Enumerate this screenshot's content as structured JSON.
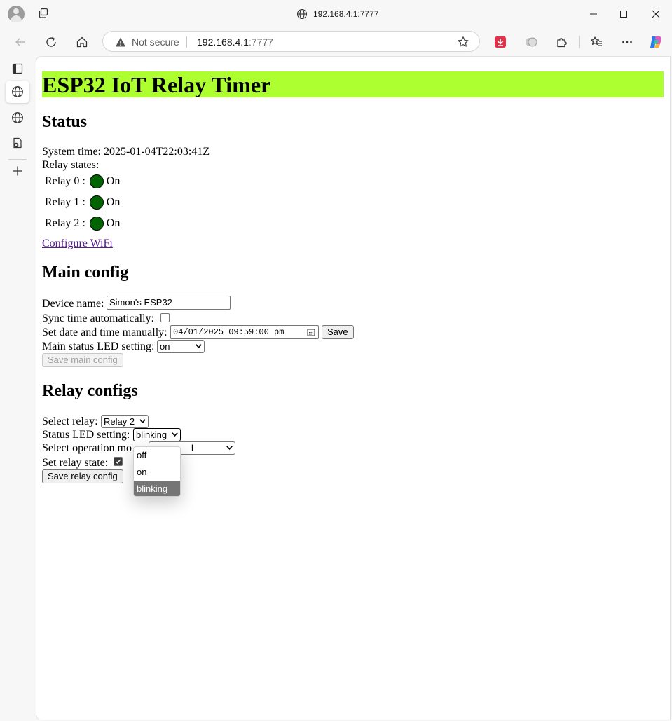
{
  "browser": {
    "window_title": "192.168.4.1:7777",
    "address": {
      "security_label": "Not secure",
      "host": "192.168.4.1",
      "port": ":7777"
    }
  },
  "page": {
    "title": "ESP32 IoT Relay Timer",
    "title_color": "#adff2f",
    "status": {
      "heading": "Status",
      "system_time_label": "System time:",
      "system_time": "2025-01-04T22:03:41Z",
      "relay_states_label": "Relay states:",
      "led_color": "#006400",
      "relays": [
        {
          "label": "Relay 0 :",
          "state": "On"
        },
        {
          "label": "Relay 1 :",
          "state": "On"
        },
        {
          "label": "Relay 2 :",
          "state": "On"
        }
      ],
      "configure_wifi_link": "Configure WiFi"
    },
    "main_config": {
      "heading": "Main config",
      "device_name_label": "Device name:",
      "device_name_value": "Simon's ESP32",
      "sync_time_label": "Sync time automatically:",
      "sync_time_checked": false,
      "set_datetime_label": "Set date and time manually:",
      "datetime_value": "04/01/2025 09:59:00 pm",
      "save_datetime_button": "Save",
      "status_led_label": "Main status LED setting:",
      "status_led_value": "on",
      "save_main_button": "Save main config"
    },
    "relay_configs": {
      "heading": "Relay configs",
      "select_relay_label": "Select relay:",
      "select_relay_value": "Relay 2",
      "status_led_label": "Status LED setting:",
      "status_led_value": "blinking",
      "operation_mode_label": "Select operation mode:",
      "operation_mode_label_visible": "Select operation mo",
      "operation_mode_value_visible": "l",
      "set_relay_state_label": "Set relay state:",
      "set_relay_state_checked": true,
      "save_relay_button": "Save relay config",
      "led_dropdown_options": [
        "off",
        "on",
        "blinking"
      ],
      "led_dropdown_highlighted": "blinking"
    }
  }
}
